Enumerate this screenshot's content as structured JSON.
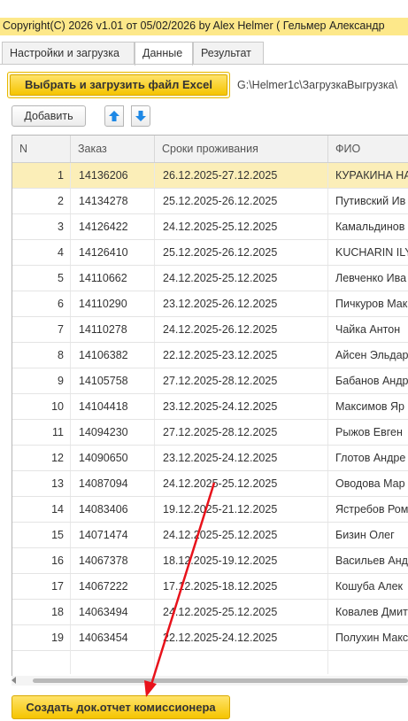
{
  "title": "Copyright(C)  2026 v1.01 от 05/02/2026  by Alex Helmer ( Гельмер Александр",
  "tabs": [
    {
      "label": "Настройки и загрузка"
    },
    {
      "label": "Данные"
    },
    {
      "label": "Результат"
    }
  ],
  "toolbar": {
    "excel_button": "Выбрать и загрузить файл Excel",
    "file_path": "G:\\Helmer1c\\ЗагрузкаВыгрузка\\",
    "add_button": "Добавить",
    "move_up_icon": "arrow-up-icon",
    "move_down_icon": "arrow-down-icon"
  },
  "table": {
    "columns": [
      "N",
      "Заказ",
      "Сроки проживания",
      "ФИО"
    ],
    "rows": [
      {
        "n": "1",
        "order": "14136206",
        "dates": "26.12.2025-27.12.2025",
        "fio": "КУРАКИНА НА"
      },
      {
        "n": "2",
        "order": "14134278",
        "dates": "25.12.2025-26.12.2025",
        "fio": "Путивский Ив"
      },
      {
        "n": "3",
        "order": "14126422",
        "dates": "24.12.2025-25.12.2025",
        "fio": "Камальдинов"
      },
      {
        "n": "4",
        "order": "14126410",
        "dates": "25.12.2025-26.12.2025",
        "fio": "KUCHARIN ILY"
      },
      {
        "n": "5",
        "order": "14110662",
        "dates": "24.12.2025-25.12.2025",
        "fio": "Левченко Ива"
      },
      {
        "n": "6",
        "order": "14110290",
        "dates": "23.12.2025-26.12.2025",
        "fio": "Пичкуров Мак"
      },
      {
        "n": "7",
        "order": "14110278",
        "dates": "24.12.2025-26.12.2025",
        "fio": "Чайка Антон"
      },
      {
        "n": "8",
        "order": "14106382",
        "dates": "22.12.2025-23.12.2025",
        "fio": "Айсен Эльдар"
      },
      {
        "n": "9",
        "order": "14105758",
        "dates": "27.12.2025-28.12.2025",
        "fio": "Бабанов Андр"
      },
      {
        "n": "10",
        "order": "14104418",
        "dates": "23.12.2025-24.12.2025",
        "fio": "Максимов Яр"
      },
      {
        "n": "11",
        "order": "14094230",
        "dates": "27.12.2025-28.12.2025",
        "fio": "Рыжов Евген"
      },
      {
        "n": "12",
        "order": "14090650",
        "dates": "23.12.2025-24.12.2025",
        "fio": "Глотов Андре"
      },
      {
        "n": "13",
        "order": "14087094",
        "dates": "24.12.2025-25.12.2025",
        "fio": "Оводова Мар"
      },
      {
        "n": "14",
        "order": "14083406",
        "dates": "19.12.2025-21.12.2025",
        "fio": "Ястребов Ром"
      },
      {
        "n": "15",
        "order": "14071474",
        "dates": "24.12.2025-25.12.2025",
        "fio": "Бизин Олег"
      },
      {
        "n": "16",
        "order": "14067378",
        "dates": "18.12.2025-19.12.2025",
        "fio": "Васильев Анд"
      },
      {
        "n": "17",
        "order": "14067222",
        "dates": "17.12.2025-18.12.2025",
        "fio": "Кошуба Алек"
      },
      {
        "n": "18",
        "order": "14063494",
        "dates": "24.12.2025-25.12.2025",
        "fio": "Ковалев Дмит"
      },
      {
        "n": "19",
        "order": "14063454",
        "dates": "22.12.2025-24.12.2025",
        "fio": "Полухин Макс"
      }
    ]
  },
  "footer": {
    "create_button": "Создать док.отчет комиссионера"
  },
  "colors": {
    "accent_yellow": "#f5c400",
    "selected_row": "#fbeeb8",
    "arrow_blue": "#1e88e5",
    "annotation_red": "#e8121b"
  }
}
